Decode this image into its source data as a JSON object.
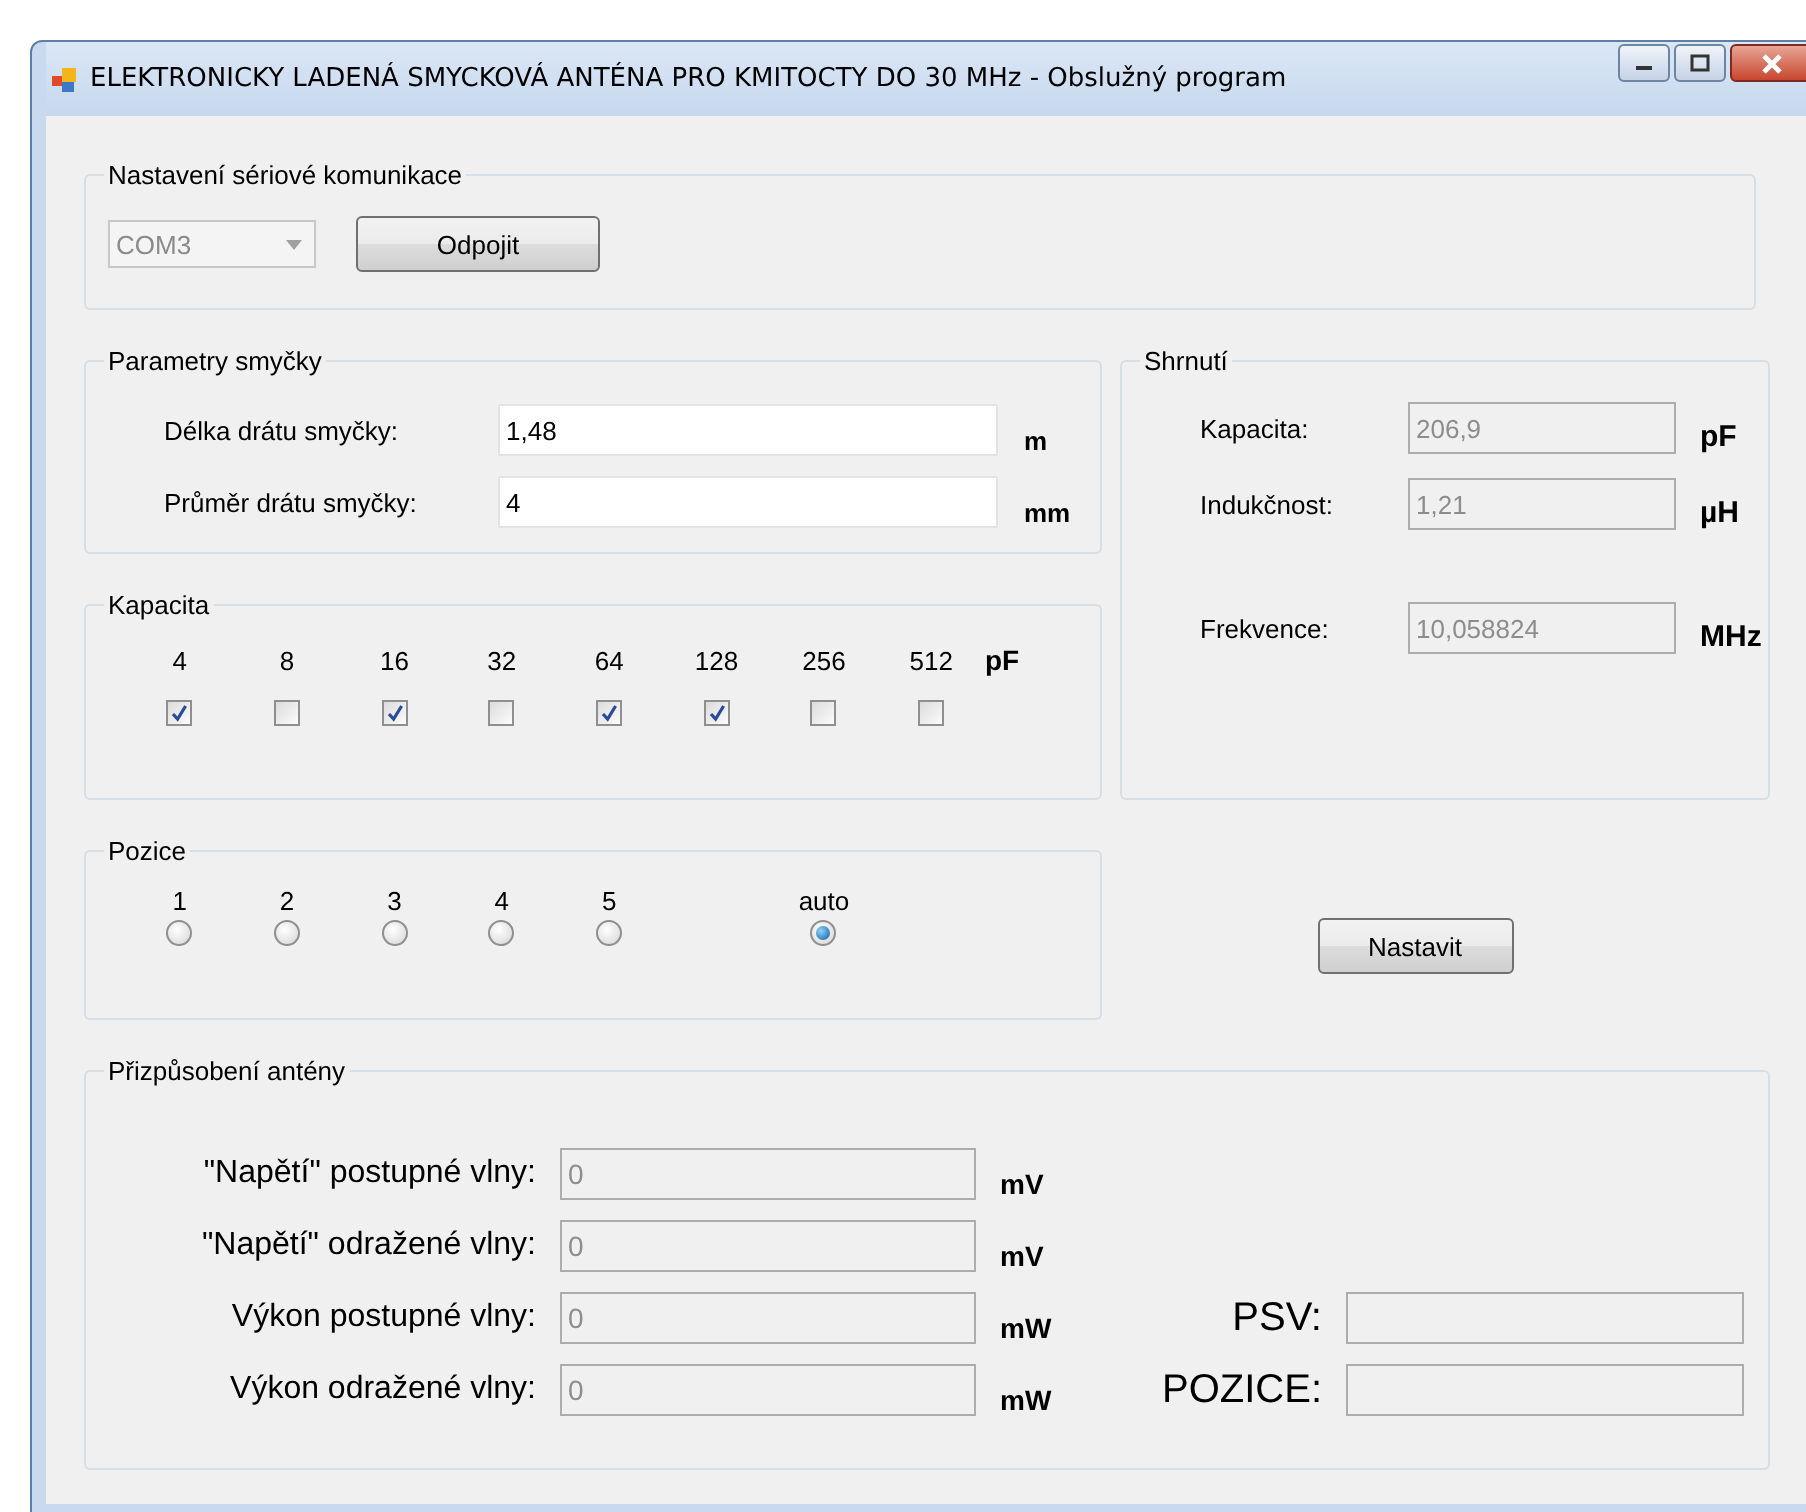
{
  "window": {
    "title": "ELEKTRONICKY LADENÁ SMYCKOVÁ ANTÉNA PRO KMITOCTY DO 30 MHz - Obslužný program"
  },
  "serial": {
    "title": "Nastavení sériové komunikace",
    "port": {
      "value": "COM3",
      "disabled": true
    },
    "button": "Odpojit"
  },
  "loop": {
    "title": "Parametry smyčky",
    "fields": [
      {
        "label": "Délka drátu smyčky:",
        "value": "1,48",
        "unit": "m",
        "disabled": false
      },
      {
        "label": "Průměr drátu smyčky:",
        "value": "4",
        "unit": "mm",
        "disabled": false
      }
    ]
  },
  "capacitance": {
    "title": "Kapacita",
    "unit": "pF",
    "switches": [
      {
        "label": "4",
        "checked": true
      },
      {
        "label": "8",
        "checked": false
      },
      {
        "label": "16",
        "checked": true
      },
      {
        "label": "32",
        "checked": false
      },
      {
        "label": "64",
        "checked": true
      },
      {
        "label": "128",
        "checked": true
      },
      {
        "label": "256",
        "checked": false
      },
      {
        "label": "512",
        "checked": false
      }
    ]
  },
  "position": {
    "title": "Pozice",
    "options": [
      {
        "label": "1",
        "selected": false
      },
      {
        "label": "2",
        "selected": false
      },
      {
        "label": "3",
        "selected": false
      },
      {
        "label": "4",
        "selected": false
      },
      {
        "label": "5",
        "selected": false
      },
      {
        "label": "auto",
        "selected": true
      }
    ]
  },
  "summary": {
    "title": "Shrnutí",
    "fields": [
      {
        "label": "Kapacita:",
        "value": "206,9",
        "unit": "pF",
        "disabled": true
      },
      {
        "label": "Indukčnost:",
        "value": "1,21",
        "unit": "µH",
        "disabled": true
      },
      {
        "label": "Frekvence:",
        "value": "10,058824",
        "unit": "MHz",
        "disabled": true
      }
    ]
  },
  "set_button": "Nastavit",
  "matching": {
    "title": "Přizpůsobení antény",
    "fields": [
      {
        "label": "\"Napětí\" postupné vlny:",
        "value": "0",
        "unit": "mV",
        "disabled": true
      },
      {
        "label": "\"Napětí\" odražené vlny:",
        "value": "0",
        "unit": "mV",
        "disabled": true
      },
      {
        "label": "Výkon postupné vlny:",
        "value": "0",
        "unit": "mW",
        "disabled": true
      },
      {
        "label": "Výkon odražené vlny:",
        "value": "0",
        "unit": "mW",
        "disabled": true
      }
    ],
    "readouts": [
      {
        "label": "PSV:",
        "disabled": true
      },
      {
        "label": "POZICE:",
        "disabled": true
      }
    ]
  }
}
